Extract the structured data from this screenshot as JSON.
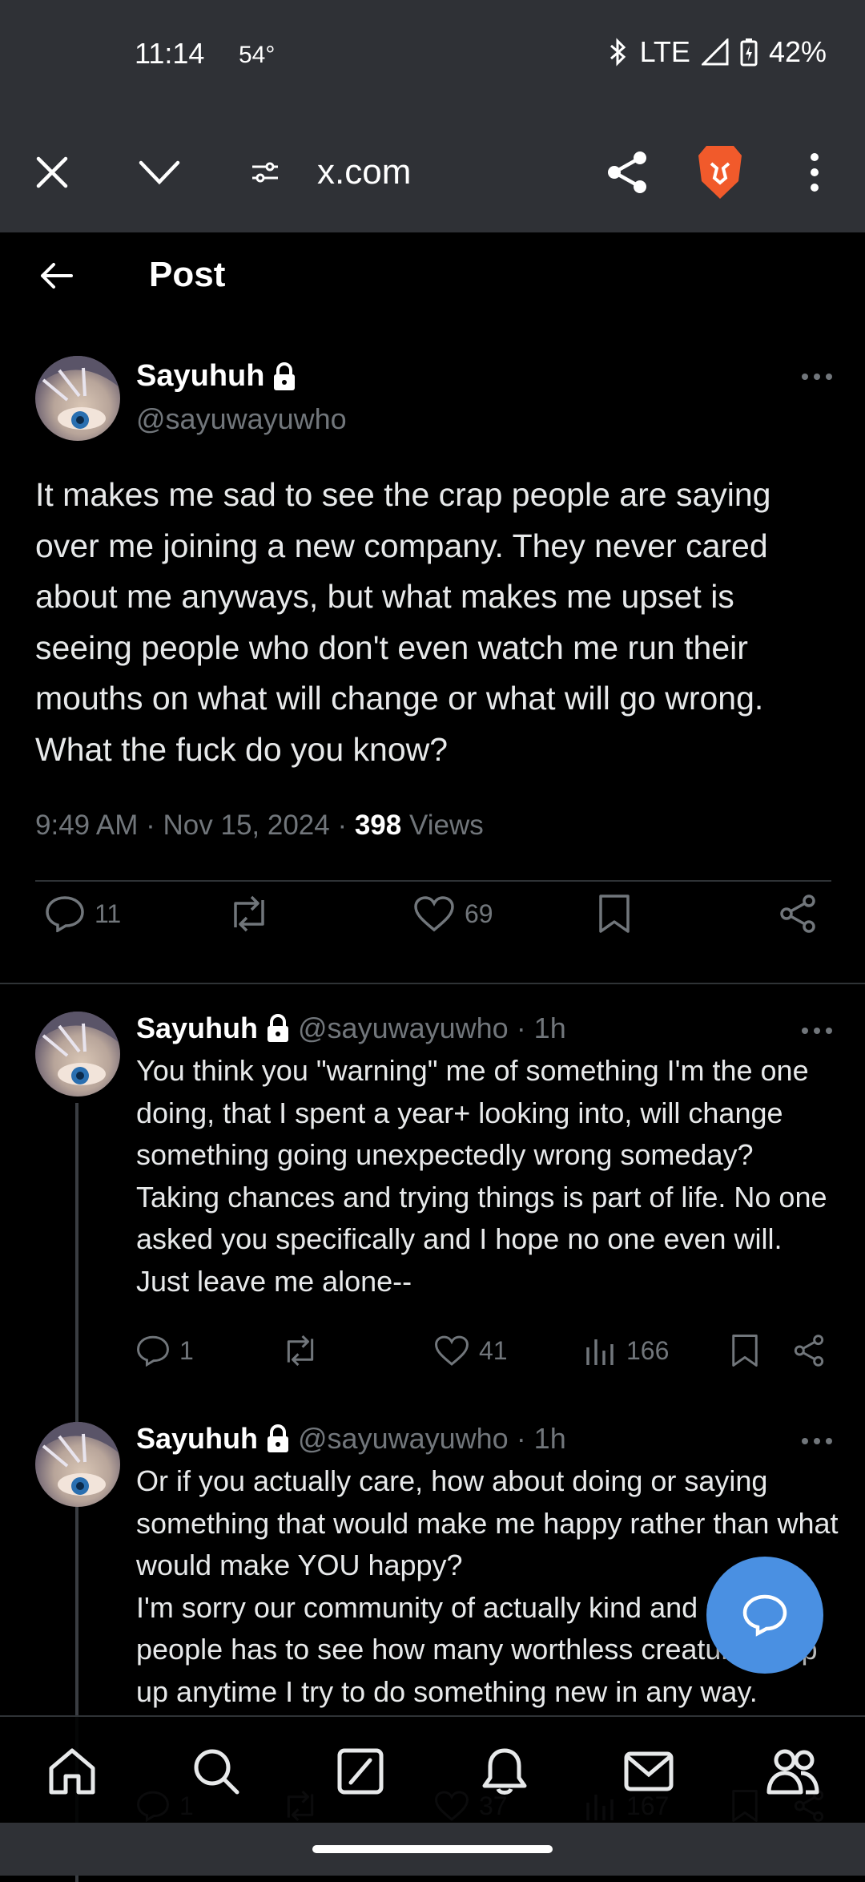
{
  "status_bar": {
    "time": "11:14",
    "temp": "54°",
    "network": "LTE",
    "battery": "42%"
  },
  "browser": {
    "url": "x.com"
  },
  "nav": {
    "title": "Post"
  },
  "post": {
    "name": "Sayuhuh",
    "handle": "@sayuwayuwho",
    "text": "It makes me sad to see the crap people are saying over me joining a new company. They never cared about me anyways, but what makes me upset is seeing people who don't even watch me run their mouths on what will change or what will go wrong. What the fuck do you know?",
    "time": "9:49 AM · Nov 15, 2024 ·",
    "views_count": "398",
    "views_label": "Views",
    "replies": "11",
    "likes": "69"
  },
  "replies": [
    {
      "name": "Sayuhuh",
      "handle": "@sayuwayuwho · 1h",
      "text": "You think you \"warning\" me of something I'm the one doing, that I spent a year+ looking into, will change something going unexpectedly wrong someday? Taking chances and trying things is part of life. No one asked you specifically and I hope no one even will. Just leave me alone--",
      "replies": "1",
      "likes": "41",
      "views": "166"
    },
    {
      "name": "Sayuhuh",
      "handle": "@sayuwayuwho · 1h",
      "text": "Or if you actually care, how about doing or saying something that would make me happy rather than what would make YOU happy?\nI'm sorry our community of actually kind and smart people has to see how many worthless creatures pop up anytime I try to do something new in any way.",
      "replies": "1",
      "likes": "37",
      "views": "167"
    }
  ]
}
